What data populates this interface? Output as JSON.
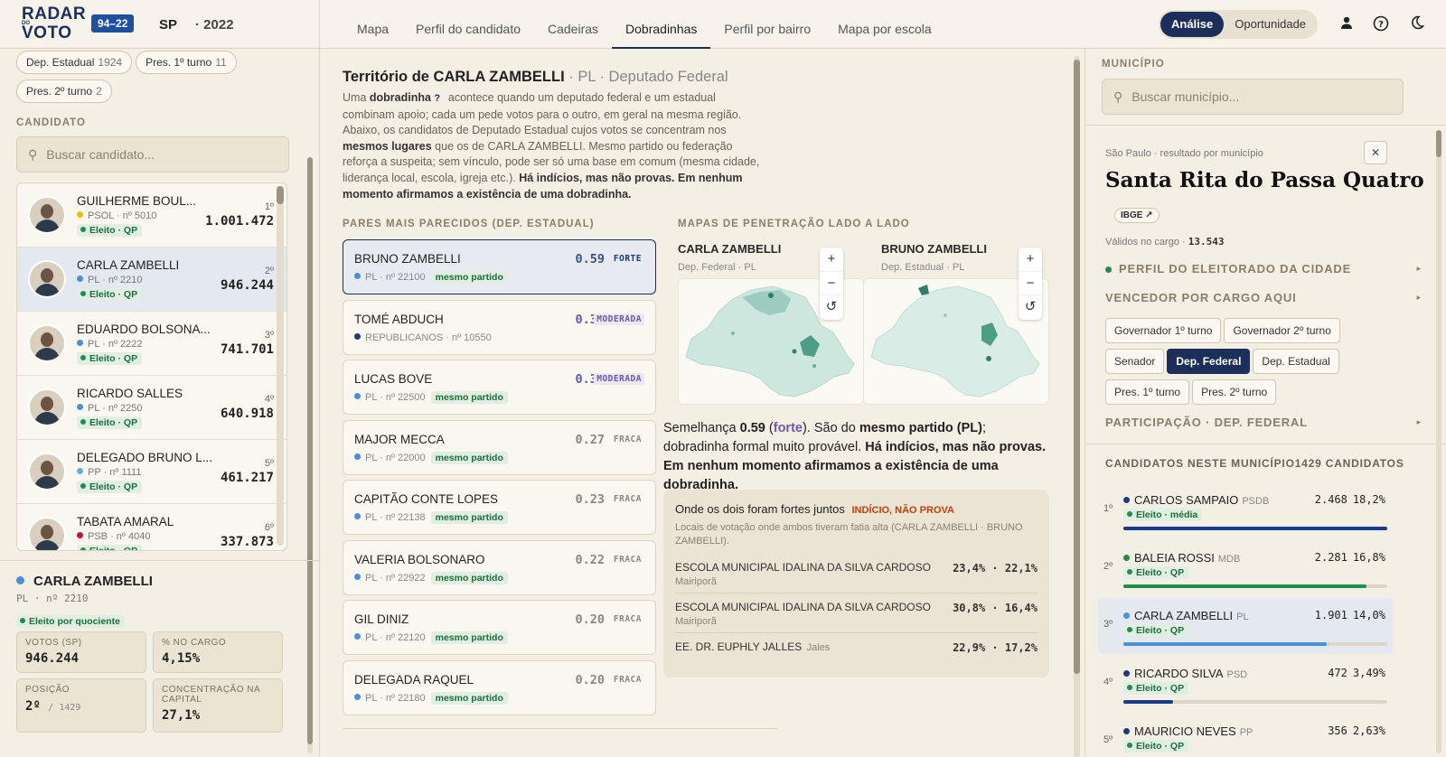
{
  "brand": {
    "logo_top": "RADAR",
    "logo_mid": "DO",
    "logo_bot": "VOTO",
    "cycle": "94–22",
    "uf": "SP",
    "year": "· 2022"
  },
  "nav": [
    "Mapa",
    "Perfil do candidato",
    "Cadeiras",
    "Dobradinhas",
    "Perfil por bairro",
    "Mapa por escola"
  ],
  "nav_active": 3,
  "mode": {
    "a": "Análise",
    "b": "Oportunidade"
  },
  "left": {
    "chips": [
      {
        "l": "Dep. Estadual",
        "n": "1924"
      },
      {
        "l": "Pres. 1º turno",
        "n": "11"
      },
      {
        "l": "Pres. 2º turno",
        "n": "2"
      }
    ],
    "cand_label": "CANDIDATO",
    "search_placeholder": "Buscar candidato...",
    "cands": [
      {
        "name": "GUILHERME BOUL...",
        "party": "PSOL · nº 5010",
        "color": "#e6c100",
        "el": "Eleito · QP",
        "rank": "1º",
        "votes": "1.001.472"
      },
      {
        "name": "CARLA ZAMBELLI",
        "party": "PL · nº 2210",
        "color": "#4a90d9",
        "el": "Eleito · QP",
        "rank": "2º",
        "votes": "946.244"
      },
      {
        "name": "EDUARDO BOLSONA...",
        "party": "PL · nº 2222",
        "color": "#4a90d9",
        "el": "Eleito · QP",
        "rank": "3º",
        "votes": "741.701"
      },
      {
        "name": "RICARDO SALLES",
        "party": "PL · nº 2250",
        "color": "#4a90d9",
        "el": "Eleito · QP",
        "rank": "4º",
        "votes": "640.918"
      },
      {
        "name": "DELEGADO BRUNO L...",
        "party": "PP · nº 1111",
        "color": "#5ab0e8",
        "el": "Eleito · QP",
        "rank": "5º",
        "votes": "461.217"
      },
      {
        "name": "TABATA AMARAL",
        "party": "PSB · nº 4040",
        "color": "#c8102e",
        "el": "Eleito · QP",
        "rank": "6º",
        "votes": "337.873"
      }
    ],
    "sel": {
      "name": "CARLA ZAMBELLI",
      "sub": "PL · nº 2210",
      "status": "Eleito por quociente",
      "stats": [
        {
          "k": "VOTOS (SP)",
          "v": "946.244"
        },
        {
          "k": "% NO CARGO",
          "v": "4,15%"
        },
        {
          "k": "POSIÇÃO",
          "v": "2º",
          "v2": "/ 1429"
        },
        {
          "k": "CONCENTRAÇÃO NA CAPITAL",
          "v": "27,1%"
        }
      ]
    }
  },
  "mid": {
    "title": "Território de CARLA ZAMBELLI",
    "title_sub": "· PL · Deputado Federal",
    "p1": "Uma ",
    "p1b": "dobradinha",
    "p1c": " acontece quando um deputado federal e um estadual combinam apoio; cada um pede votos para o outro, em geral na mesma região. Abaixo, os candidatos de Deputado Estadual cujos votos se concentram nos ",
    "p1d": "mesmos lugares",
    "p1e": " que os de CARLA ZAMBELLI. Mesmo partido ou federação reforça a suspeita; sem vínculo, pode ser só uma base em comum (mesma cidade, liderança local, escola, igreja etc.). ",
    "p1f": "Há indícios, mas não provas. Em nenhum momento afirmamos a existência de uma dobradinha.",
    "help": "?",
    "pairs_label": "PARES MAIS PARECIDOS (DEP. ESTADUAL)",
    "same_label": "mesmo partido",
    "pairs": [
      {
        "name": "BRUNO ZAMBELLI",
        "party": "PL · nº 22100",
        "color": "#4a90d9",
        "score": "0.59",
        "tag": "FORTE",
        "same": true
      },
      {
        "name": "TOMÉ ABDUCH",
        "party": "REPUBLICANOS · nº 10550",
        "color": "#1c3a7a",
        "score": "0.35",
        "tag": "MODERADA",
        "same": false
      },
      {
        "name": "LUCAS BOVE",
        "party": "PL · nº 22500",
        "color": "#4a90d9",
        "score": "0.30",
        "tag": "MODERADA",
        "same": true
      },
      {
        "name": "MAJOR MECCA",
        "party": "PL · nº 22000",
        "color": "#4a90d9",
        "score": "0.27",
        "tag": "FRACA",
        "same": true
      },
      {
        "name": "CAPITÃO CONTE LOPES",
        "party": "PL · nº 22138",
        "color": "#4a90d9",
        "score": "0.23",
        "tag": "FRACA",
        "same": true
      },
      {
        "name": "VALERIA BOLSONARO",
        "party": "PL · nº 22922",
        "color": "#4a90d9",
        "score": "0.22",
        "tag": "FRACA",
        "same": true
      },
      {
        "name": "GIL DINIZ",
        "party": "PL · nº 22120",
        "color": "#4a90d9",
        "score": "0.20",
        "tag": "FRACA",
        "same": true
      },
      {
        "name": "DELEGADA RAQUEL",
        "party": "PL · nº 22180",
        "color": "#4a90d9",
        "score": "0.20",
        "tag": "FRACA",
        "same": true
      }
    ],
    "maps_label": "MAPAS DE PENETRAÇÃO LADO A LADO",
    "mapA": {
      "name": "CARLA ZAMBELLI",
      "sub": "Dep. Federal · PL"
    },
    "mapB": {
      "name": "BRUNO ZAMBELLI",
      "sub": "Dep. Estadual · PL"
    },
    "sim_a": "Semelhança ",
    "sim_score": "0.59",
    "sim_paren_open": " (",
    "sim_strength": "forte",
    "sim_b": "). São do ",
    "sim_party": "mesmo partido (PL)",
    "sim_c": "; dobradinha formal muito provável. ",
    "sim_d": "Há indícios, mas não provas. Em nenhum momento afirmamos a existência de uma dobradinha.",
    "ev_title": "Onde os dois foram fortes juntos",
    "ev_tag": "INDÍCIO, NÃO PROVA",
    "ev_desc": "Locais de votação onde ambos tiveram fatia alta (CARLA ZAMBELLI · BRUNO ZAMBELLI).",
    "ev_rows": [
      {
        "school": "ESCOLA MUNICIPAL IDALINA DA SILVA CARDOSO",
        "city": "Mairiporã",
        "pct": "23,4% · 22,1%"
      },
      {
        "school": "ESCOLA MUNICIPAL IDALINA DA SILVA CARDOSO",
        "city": "Mairiporã",
        "pct": "30,8% · 16,4%"
      },
      {
        "school": "EE. DR. EUPHLY JALLES",
        "city": "Jales",
        "pct": "22,9% · 17,2%"
      }
    ]
  },
  "right": {
    "mun_label": "MUNICÍPIO",
    "mun_placeholder": "Buscar município...",
    "ctx": "São Paulo · resultado por município",
    "city": "Santa Rita do Passa Quatro",
    "ibge": "IBGE ↗",
    "valid_label": "Válidos no cargo · ",
    "valid": "13.543",
    "perfil": "PERFIL DO ELEITORADO DA CIDADE",
    "vencedor": "VENCEDOR POR CARGO AQUI",
    "cargos": [
      "Governador 1º turno",
      "Governador 2º turno",
      "Senador",
      "Dep. Federal",
      "Dep. Estadual",
      "Pres. 1º turno",
      "Pres. 2º turno"
    ],
    "cargo_active": 3,
    "part": "PARTICIPAÇÃO · DEP. FEDERAL",
    "cands_label": "CANDIDATOS NESTE MUNICÍPIO",
    "cands_count": "1429 CANDIDATOS",
    "cands": [
      {
        "rank": "1º",
        "name": "CARLOS SAMPAIO",
        "party": "PSDB",
        "color": "#1c3a8a",
        "el": "Eleito · média",
        "v": "2.468",
        "p": "18,2%",
        "bar": 1.0
      },
      {
        "rank": "2º",
        "name": "BALEIA ROSSI",
        "party": "MDB",
        "color": "#1d8e4c",
        "el": "Eleito · QP",
        "v": "2.281",
        "p": "16,8%",
        "bar": 0.92
      },
      {
        "rank": "3º",
        "name": "CARLA ZAMBELLI",
        "party": "PL",
        "color": "#4a90d9",
        "el": "Eleito · QP",
        "v": "1.901",
        "p": "14,0%",
        "bar": 0.77
      },
      {
        "rank": "4º",
        "name": "RICARDO SILVA",
        "party": "PSD",
        "color": "#1c3a8a",
        "el": "Eleito · QP",
        "v": "472",
        "p": "3,49%",
        "bar": 0.19
      },
      {
        "rank": "5º",
        "name": "MAURICIO NEVES",
        "party": "PP",
        "color": "#1c3a8a",
        "el": "Eleito · QP",
        "v": "356",
        "p": "2,63%",
        "bar": 0.15
      }
    ]
  },
  "colors": {
    "navy": "#1c2e5a",
    "green": "#1d8e4c",
    "pl_blue": "#4a90d9"
  },
  "icons": [
    "user-icon",
    "help-icon",
    "moon-icon",
    "search-icon",
    "close-icon",
    "zoom-in-icon",
    "zoom-out-icon",
    "reset-icon"
  ]
}
